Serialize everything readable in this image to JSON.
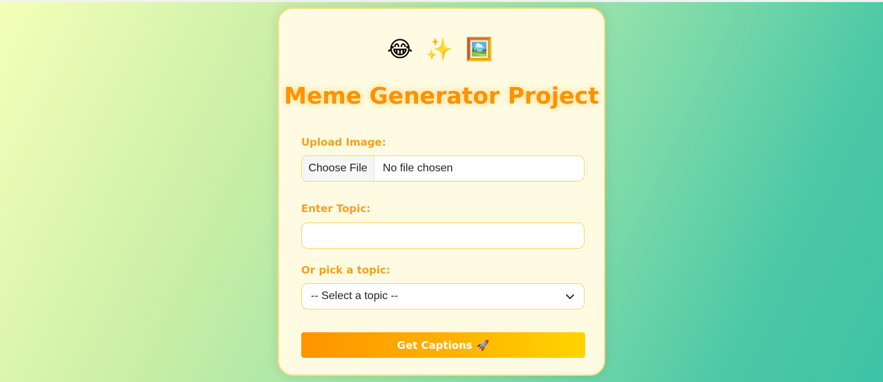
{
  "header": {
    "emojis": "😂 ✨ 🖼️",
    "title": "Meme Generator Project"
  },
  "form": {
    "upload": {
      "label": "Upload Image:",
      "button_label": "Choose File",
      "status": "No file chosen"
    },
    "topic": {
      "label": "Enter Topic:",
      "value": "",
      "placeholder": ""
    },
    "pick_topic": {
      "label": "Or pick a topic:",
      "selected": "-- Select a topic --"
    },
    "submit": {
      "label": "Get Captions",
      "emoji": "🚀"
    }
  },
  "colors": {
    "accent": "#ff9100",
    "label": "#f5a020",
    "card_background": "#fffbe3",
    "card_border": "#ffe082"
  },
  "icons": {
    "select_arrow": "chevron-down-icon"
  }
}
